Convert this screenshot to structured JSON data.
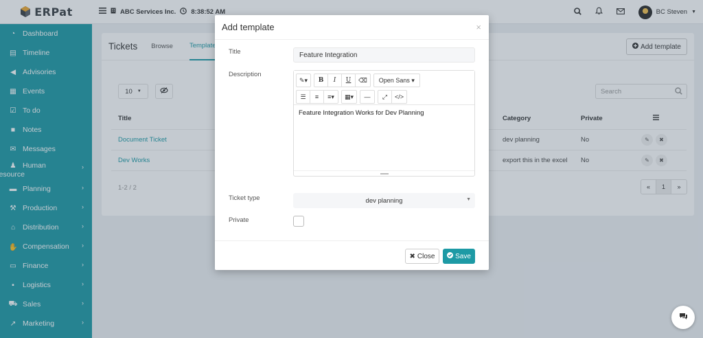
{
  "brand": {
    "name": "ERPat",
    "accent": "#1d9aa5"
  },
  "header": {
    "company": "ABC Services Inc.",
    "time": "8:38:52 AM",
    "user": "BC Steven"
  },
  "sidebar": {
    "items": [
      {
        "label": "Dashboard",
        "icon": "dashboard-icon"
      },
      {
        "label": "Timeline",
        "icon": "timeline-icon"
      },
      {
        "label": "Advisories",
        "icon": "bullhorn-icon"
      },
      {
        "label": "Events",
        "icon": "calendar-icon"
      },
      {
        "label": "To do",
        "icon": "checkbox-icon"
      },
      {
        "label": "Notes",
        "icon": "notes-icon"
      },
      {
        "label": "Messages",
        "icon": "envelope-icon"
      },
      {
        "label": "Human",
        "label2": "Resource",
        "icon": "users-icon",
        "chevron": true
      },
      {
        "label": "Planning",
        "icon": "briefcase-icon",
        "chevron": true
      },
      {
        "label": "Production",
        "icon": "gavel-icon",
        "chevron": true
      },
      {
        "label": "Distribution",
        "icon": "bank-icon",
        "chevron": true
      },
      {
        "label": "Compensation",
        "icon": "handshake-icon",
        "chevron": true
      },
      {
        "label": "Finance",
        "icon": "money-icon",
        "chevron": true
      },
      {
        "label": "Logistics",
        "icon": "truck-icon",
        "chevron": true
      },
      {
        "label": "Sales",
        "icon": "cart-icon",
        "chevron": true
      },
      {
        "label": "Marketing",
        "icon": "chart-icon",
        "chevron": true
      }
    ]
  },
  "page": {
    "title": "Tickets",
    "tabs": [
      "Browse",
      "Templates"
    ],
    "add_template": "Add template",
    "page_size": "10",
    "search_placeholder": "Search",
    "columns": {
      "title": "Title",
      "category": "Category",
      "private": "Private"
    },
    "rows": [
      {
        "title": "Document Ticket",
        "category": "dev planning",
        "private": "No"
      },
      {
        "title": "Dev Works",
        "category": "export this in the excel",
        "private": "No"
      }
    ],
    "count": "1-2 / 2",
    "pager": {
      "prev": "«",
      "current": "1",
      "next": "»"
    }
  },
  "modal": {
    "title": "Add template",
    "close_x": "×",
    "labels": {
      "title": "Title",
      "description": "Description",
      "ticket_type": "Ticket type",
      "private": "Private"
    },
    "title_value": "Feature Integration",
    "font_name": "Open Sans",
    "description_value": "Feature Integration Works for Dev Planning",
    "ticket_type_value": "dev planning",
    "close_button": "Close",
    "save_button": "Save"
  }
}
